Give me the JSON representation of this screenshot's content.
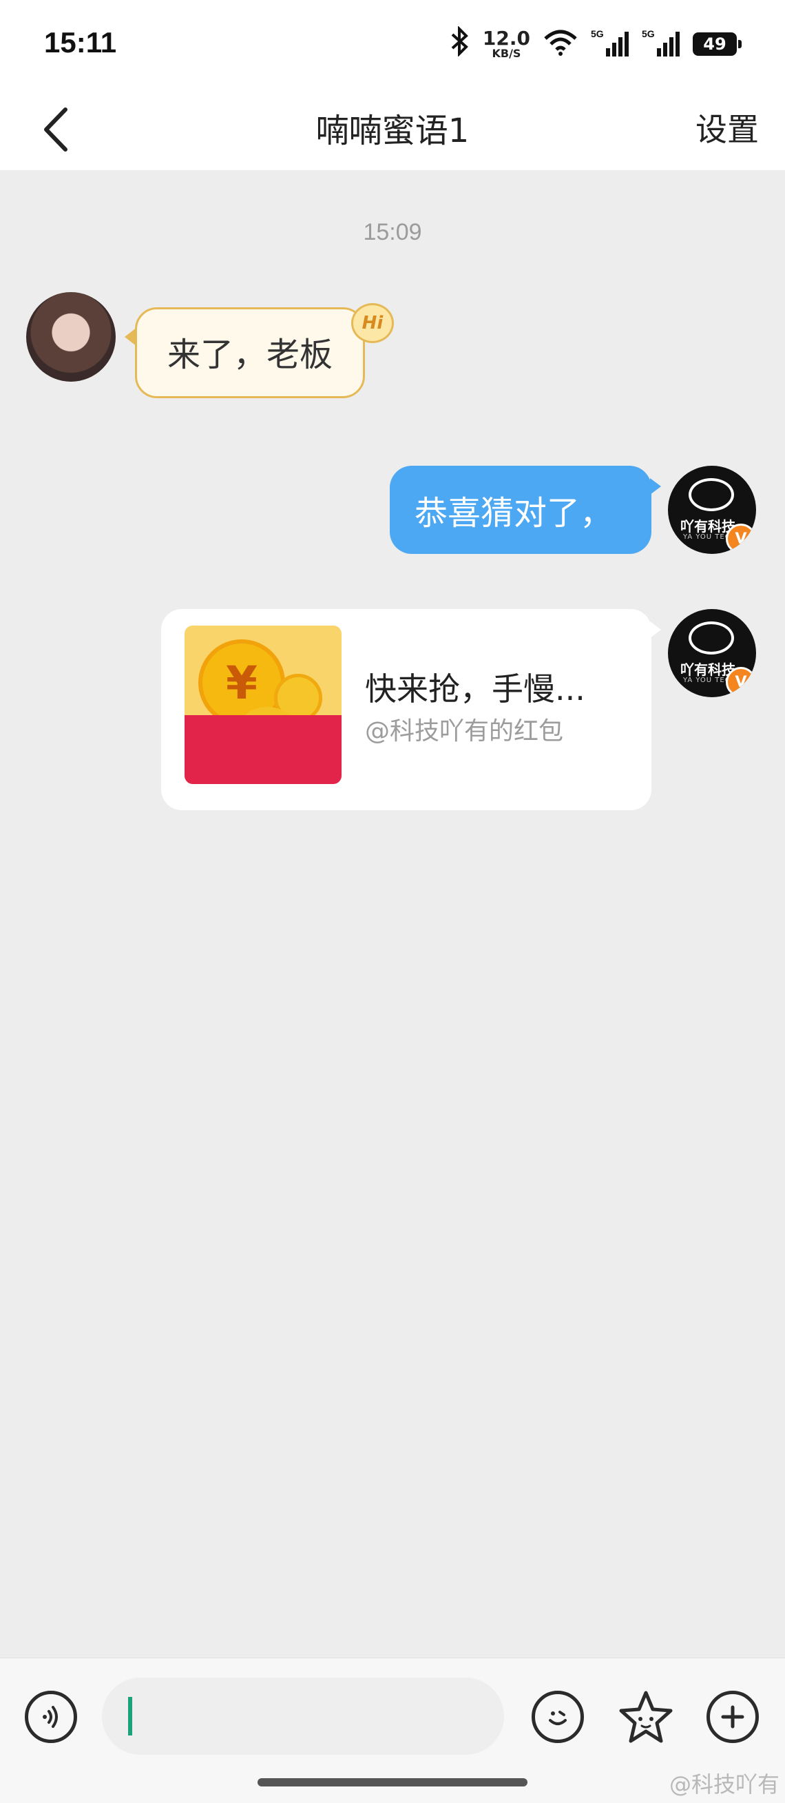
{
  "status_bar": {
    "time": "15:11",
    "network_speed": "12.0",
    "network_unit": "KB/S",
    "signal_1": "5G",
    "signal_2": "5G",
    "battery": "49"
  },
  "header": {
    "title": "喃喃蜜语1",
    "settings_label": "设置"
  },
  "chat": {
    "timestamp": "15:09",
    "messages": [
      {
        "side": "left",
        "text": "来了，老板",
        "badge": "Hi"
      },
      {
        "side": "right",
        "text": "恭喜猜对了，"
      },
      {
        "side": "right",
        "type": "red_packet",
        "title": "快来抢，手慢...",
        "subtitle": "@科技吖有的红包"
      }
    ],
    "avatar_brand_text": "吖有科技",
    "avatar_brand_sub": "YA YOU TECHNO",
    "verified_badge": "V"
  },
  "input_bar": {
    "placeholder": ""
  },
  "watermark": "@科技吖有",
  "colors": {
    "bubble_blue": "#4da8f3",
    "red_packet": "#e3244a",
    "verified": "#f5861f"
  }
}
